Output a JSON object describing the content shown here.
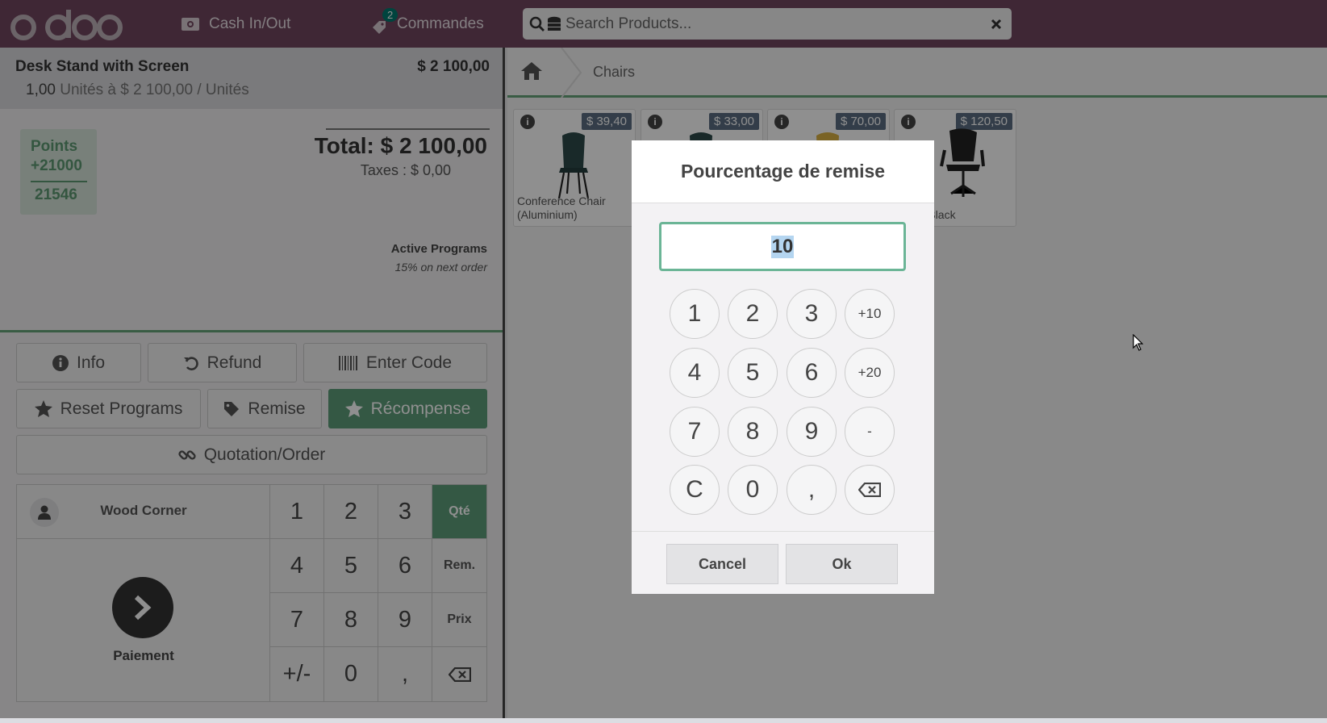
{
  "header": {
    "logo_text": "odoo",
    "cash_label": "Cash In/Out",
    "orders_label": "Commandes",
    "orders_badge": "2",
    "search_placeholder": "Search Products..."
  },
  "order": {
    "line_name": "Desk Stand with Screen",
    "line_price": "$ 2 100,00",
    "line_qty": "1,00",
    "line_detail": "Unités à $ 2 100,00 / Unités",
    "points_label": "Points",
    "points_gain": "+21000",
    "points_total": "21546",
    "total": "Total: $ 2 100,00",
    "taxes": "Taxes : $ 0,00",
    "active_programs_title": "Active Programs",
    "active_program": "15% on next order"
  },
  "controls": {
    "info": "Info",
    "refund": "Refund",
    "enter_code": "Enter Code",
    "reset_programs": "Reset Programs",
    "remise": "Remise",
    "recompense": "Récompense",
    "quotation": "Quotation/Order"
  },
  "numpad": {
    "customer": "Wood Corner",
    "payment": "Paiement",
    "keys": [
      "1",
      "2",
      "3",
      "Qté",
      "4",
      "5",
      "6",
      "Rem.",
      "7",
      "8",
      "9",
      "Prix",
      "+/-",
      "0",
      ","
    ]
  },
  "products": {
    "breadcrumb": "Chairs",
    "items": [
      {
        "name": "Conference Chair (Aluminium)",
        "price": "$ 39,40"
      },
      {
        "name": "",
        "price": "$ 33,00"
      },
      {
        "name": "",
        "price": "$ 70,00"
      },
      {
        "name": "Chair Black",
        "price": "$ 120,50"
      }
    ]
  },
  "dialog": {
    "title": "Pourcentage de remise",
    "value": "10",
    "keys": [
      "1",
      "2",
      "3",
      "+10",
      "4",
      "5",
      "6",
      "+20",
      "7",
      "8",
      "9",
      "-",
      "C",
      "0",
      ","
    ],
    "cancel": "Cancel",
    "ok": "Ok"
  },
  "colors": {
    "header": "#71465f",
    "accent_green": "#5e9e79",
    "badge": "#01796f"
  }
}
